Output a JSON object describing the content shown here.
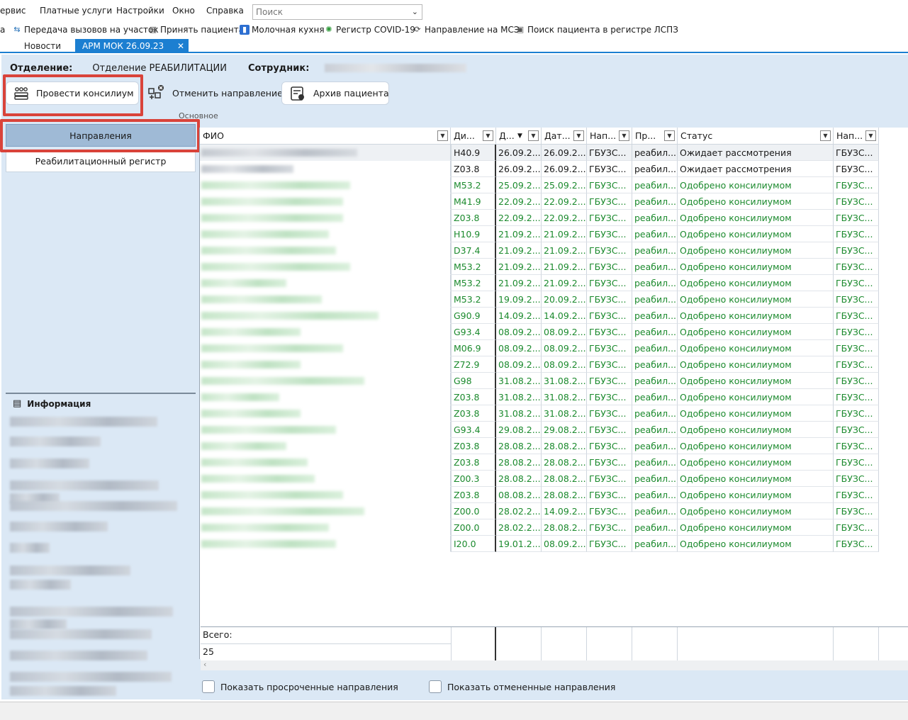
{
  "menu": [
    "ервис",
    "Платные услуги",
    "Настройки",
    "Окно",
    "Справка"
  ],
  "search": {
    "placeholder": "Поиск"
  },
  "quickbar": [
    {
      "label": "а",
      "icon": ""
    },
    {
      "label": "Передача вызовов на участок",
      "icon": "network-icon"
    },
    {
      "label": "Принять пациента",
      "icon": "receive-patient-icon"
    },
    {
      "label": "Молочная кухня",
      "icon": "milk-bottle-icon"
    },
    {
      "label": "Регистр COVID-19",
      "icon": "virus-icon"
    },
    {
      "label": "Направление на МСЭ",
      "icon": "referral-icon"
    },
    {
      "label": "Поиск пациента в регистре ЛСПЗ",
      "icon": "search-patient-icon"
    }
  ],
  "tabs": {
    "news": "Новости",
    "arm": "АРМ МОК 26.09.23",
    "close": "✕"
  },
  "header": {
    "dept_label": "Отделение:",
    "dept_value": "Отделение РЕАБИЛИТАЦИИ",
    "employee_label": "Сотрудник:"
  },
  "ribbon": {
    "consilium": "Провести консилиум",
    "cancel": "Отменить направление",
    "archive": "Архив пациента",
    "group": "Основное"
  },
  "nav": {
    "directions": "Направления",
    "registry": "Реабилитационный регистр"
  },
  "info": {
    "title": "Информация"
  },
  "columns": [
    "ФИО",
    "Ди...",
    "Д...",
    "Дат...",
    "Нап...",
    "Пр...",
    "Статус",
    "Нап..."
  ],
  "rows": [
    [
      "H40.9",
      "26.09.2...",
      "26.09.2...",
      "ГБУЗС...",
      "реабил...",
      "Ожидает рассмотрения",
      "ГБУЗС..."
    ],
    [
      "Z03.8",
      "26.09.2...",
      "26.09.2...",
      "ГБУЗС...",
      "реабил...",
      "Ожидает рассмотрения",
      "ГБУЗС..."
    ],
    [
      "M53.2",
      "25.09.2...",
      "25.09.2...",
      "ГБУЗС...",
      "реабил...",
      "Одобрено консилиумом",
      "ГБУЗС..."
    ],
    [
      "M41.9",
      "22.09.2...",
      "22.09.2...",
      "ГБУЗС...",
      "реабил...",
      "Одобрено консилиумом",
      "ГБУЗС..."
    ],
    [
      "Z03.8",
      "22.09.2...",
      "22.09.2...",
      "ГБУЗС...",
      "реабил...",
      "Одобрено консилиумом",
      "ГБУЗС..."
    ],
    [
      "H10.9",
      "21.09.2...",
      "21.09.2...",
      "ГБУЗС...",
      "реабил...",
      "Одобрено консилиумом",
      "ГБУЗС..."
    ],
    [
      "D37.4",
      "21.09.2...",
      "21.09.2...",
      "ГБУЗС...",
      "реабил...",
      "Одобрено консилиумом",
      "ГБУЗС..."
    ],
    [
      "M53.2",
      "21.09.2...",
      "21.09.2...",
      "ГБУЗС...",
      "реабил...",
      "Одобрено консилиумом",
      "ГБУЗС..."
    ],
    [
      "M53.2",
      "21.09.2...",
      "21.09.2...",
      "ГБУЗС...",
      "реабил...",
      "Одобрено консилиумом",
      "ГБУЗС..."
    ],
    [
      "M53.2",
      "19.09.2...",
      "20.09.2...",
      "ГБУЗС...",
      "реабил...",
      "Одобрено консилиумом",
      "ГБУЗС..."
    ],
    [
      "G90.9",
      "14.09.2...",
      "14.09.2...",
      "ГБУЗС...",
      "реабил...",
      "Одобрено консилиумом",
      "ГБУЗС..."
    ],
    [
      "G93.4",
      "08.09.2...",
      "08.09.2...",
      "ГБУЗС...",
      "реабил...",
      "Одобрено консилиумом",
      "ГБУЗС..."
    ],
    [
      "M06.9",
      "08.09.2...",
      "08.09.2...",
      "ГБУЗС...",
      "реабил...",
      "Одобрено консилиумом",
      "ГБУЗС..."
    ],
    [
      "Z72.9",
      "08.09.2...",
      "08.09.2...",
      "ГБУЗС...",
      "реабил...",
      "Одобрено консилиумом",
      "ГБУЗС..."
    ],
    [
      "G98",
      "31.08.2...",
      "31.08.2...",
      "ГБУЗС...",
      "реабил...",
      "Одобрено консилиумом",
      "ГБУЗС..."
    ],
    [
      "Z03.8",
      "31.08.2...",
      "31.08.2...",
      "ГБУЗС...",
      "реабил...",
      "Одобрено консилиумом",
      "ГБУЗС..."
    ],
    [
      "Z03.8",
      "31.08.2...",
      "31.08.2...",
      "ГБУЗС...",
      "реабил...",
      "Одобрено консилиумом",
      "ГБУЗС..."
    ],
    [
      "G93.4",
      "29.08.2...",
      "29.08.2...",
      "ГБУЗС...",
      "реабил...",
      "Одобрено консилиумом",
      "ГБУЗС..."
    ],
    [
      "Z03.8",
      "28.08.2...",
      "28.08.2...",
      "ГБУЗС...",
      "реабил...",
      "Одобрено консилиумом",
      "ГБУЗС..."
    ],
    [
      "Z03.8",
      "28.08.2...",
      "28.08.2...",
      "ГБУЗС...",
      "реабил...",
      "Одобрено консилиумом",
      "ГБУЗС..."
    ],
    [
      "Z00.3",
      "28.08.2...",
      "28.08.2...",
      "ГБУЗС...",
      "реабил...",
      "Одобрено консилиумом",
      "ГБУЗС..."
    ],
    [
      "Z03.8",
      "08.08.2...",
      "28.08.2...",
      "ГБУЗС...",
      "реабил...",
      "Одобрено консилиумом",
      "ГБУЗС..."
    ],
    [
      "Z00.0",
      "28.02.2...",
      "14.09.2...",
      "ГБУЗС...",
      "реабил...",
      "Одобрено консилиумом",
      "ГБУЗС..."
    ],
    [
      "Z00.0",
      "28.02.2...",
      "28.08.2...",
      "ГБУЗС...",
      "реабил...",
      "Одобрено консилиумом",
      "ГБУЗС..."
    ],
    [
      "I20.0",
      "19.01.2...",
      "08.09.2...",
      "ГБУЗС...",
      "реабил...",
      "Одобрено консилиумом",
      "ГБУЗС..."
    ]
  ],
  "footer": {
    "total_label": "Всего:",
    "total_value": "25"
  },
  "options": {
    "overdue": "Показать просроченные направления",
    "cancelled": "Показать отмененные направления"
  },
  "colors": {
    "accent": "#1c7fd1",
    "highlight": "#d9433a",
    "approved": "#1b8a2d",
    "panel": "#dbe8f5"
  }
}
